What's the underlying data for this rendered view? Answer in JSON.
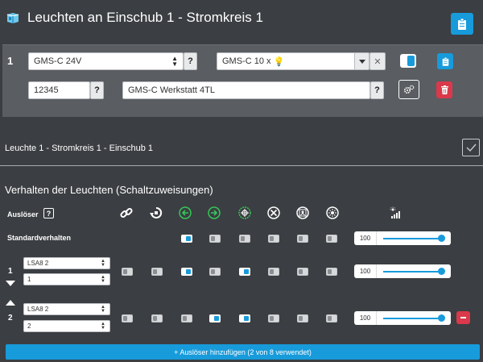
{
  "header": {
    "title": "Leuchten an Einschub 1 - Stromkreis 1"
  },
  "row1": {
    "index": "1",
    "type_select": "GMS-C 24V",
    "lamp_select": "GMS-C 10 x",
    "code_input": "12345",
    "name_input": "GMS-C Werkstatt 4TL",
    "help_label": "?",
    "clear_label": "✕"
  },
  "summary": {
    "text": "Leuchte 1 - Stromkreis 1 - Einschub 1"
  },
  "behavior": {
    "title": "Verhalten der Leuchten (Schaltzuweisungen)",
    "trigger_label": "Auslöser",
    "help_label": "?",
    "standard_label": "Standardverhalten",
    "standard_value": "100",
    "triggers": [
      {
        "index": "1",
        "sel_a": "LSA8 2",
        "sel_b": "1",
        "value": "100"
      },
      {
        "index": "2",
        "sel_a": "LSA8 2",
        "sel_b": "2",
        "value": "100"
      }
    ],
    "add_button": "+ Auslöser hinzufügen (2 von 8 verwendet)"
  },
  "colors": {
    "background": "#3b3e42",
    "panel": "#5a5d61",
    "accent": "#179bdb",
    "danger": "#d9394a",
    "green": "#34c759"
  }
}
